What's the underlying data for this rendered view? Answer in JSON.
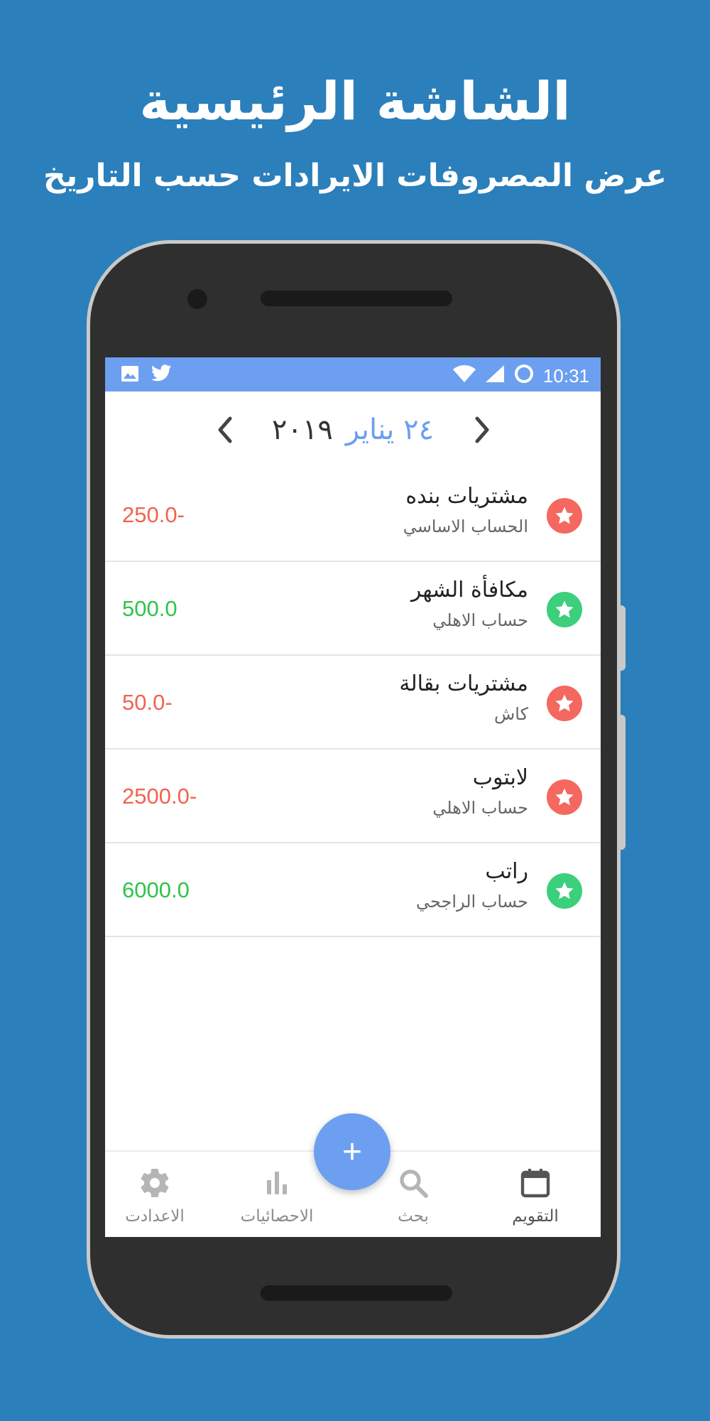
{
  "promo": {
    "title": "الشاشة الرئيسية",
    "subtitle": "عرض المصروفات الايرادات حسب التاريخ"
  },
  "status_bar": {
    "time": "10:31",
    "icons": [
      "image-icon",
      "twitter-icon",
      "wifi-icon",
      "signal-icon",
      "sync-icon"
    ],
    "color": "#6c9ff0"
  },
  "date_nav": {
    "day_month": "٢٤ يناير",
    "year": "٢٠١٩"
  },
  "transactions": [
    {
      "name": "مشتريات بنده",
      "account": "الحساب الاساسي",
      "amount": "250.0-",
      "type": "expense"
    },
    {
      "name": "مكافأة الشهر",
      "account": "حساب الاهلي",
      "amount": "500.0",
      "type": "income"
    },
    {
      "name": "مشتريات بقالة",
      "account": "كاش",
      "amount": "50.0-",
      "type": "expense"
    },
    {
      "name": "لابتوب",
      "account": "حساب الاهلي",
      "amount": "2500.0-",
      "type": "expense"
    },
    {
      "name": "راتب",
      "account": "حساب الراجحي",
      "amount": "6000.0",
      "type": "income"
    }
  ],
  "colors": {
    "expense": "#f0634e",
    "income": "#2dc44a",
    "expense_icon": "#f4685f",
    "income_icon": "#3ccf7c",
    "accent": "#6c9ff0",
    "background": "#2b7fbb"
  },
  "bottom_nav": {
    "settings": "الاعدادت",
    "stats": "الاحصائيات",
    "search": "بحث",
    "calendar": "التقويم"
  },
  "fab": {
    "label": "+"
  }
}
